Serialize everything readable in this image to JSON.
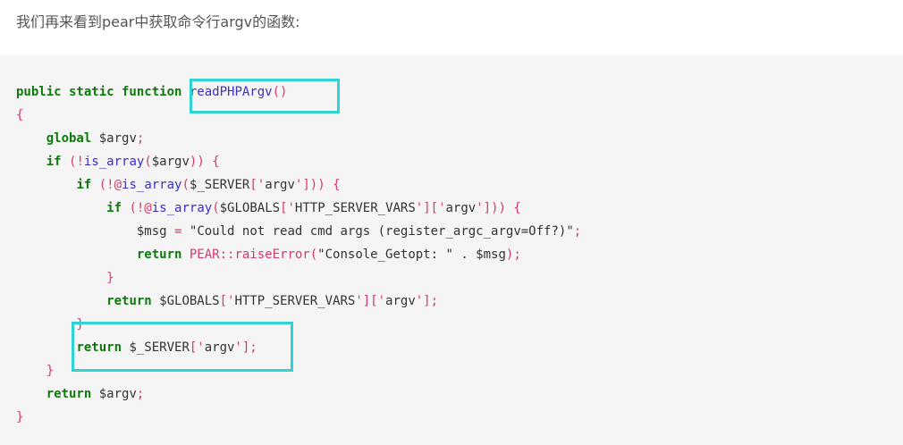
{
  "intro_text": "我们再来看到pear中获取命令行argv的函数:",
  "code_lines": [
    [
      [
        "kw",
        "public static function"
      ],
      [
        "var",
        " "
      ],
      [
        "fn",
        "readPHPArgv"
      ],
      [
        "pn",
        "()"
      ]
    ],
    [
      [
        "pn",
        "{"
      ]
    ],
    [
      [
        "var",
        "    "
      ],
      [
        "kw",
        "global"
      ],
      [
        "var",
        " $argv"
      ],
      [
        "pn",
        ";"
      ]
    ],
    [
      [
        "var",
        "    "
      ],
      [
        "kw",
        "if"
      ],
      [
        "var",
        " "
      ],
      [
        "pn",
        "(!"
      ],
      [
        "fn",
        "is_array"
      ],
      [
        "pn",
        "("
      ],
      [
        "var",
        "$argv"
      ],
      [
        "pn",
        ")) {"
      ]
    ],
    [
      [
        "var",
        "        "
      ],
      [
        "kw",
        "if"
      ],
      [
        "var",
        " "
      ],
      [
        "pn",
        "(!@"
      ],
      [
        "fn",
        "is_array"
      ],
      [
        "pn",
        "("
      ],
      [
        "var",
        "$_SERVER"
      ],
      [
        "pn",
        "['"
      ],
      [
        "str",
        "argv"
      ],
      [
        "pn",
        "'])) {"
      ]
    ],
    [
      [
        "var",
        "            "
      ],
      [
        "kw",
        "if"
      ],
      [
        "var",
        " "
      ],
      [
        "pn",
        "(!@"
      ],
      [
        "fn",
        "is_array"
      ],
      [
        "pn",
        "("
      ],
      [
        "var",
        "$GLOBALS"
      ],
      [
        "pn",
        "['"
      ],
      [
        "str",
        "HTTP_SERVER_VARS"
      ],
      [
        "pn",
        "']['"
      ],
      [
        "str",
        "argv"
      ],
      [
        "pn",
        "'])) {"
      ]
    ],
    [
      [
        "var",
        "                $msg "
      ],
      [
        "pn",
        "="
      ],
      [
        "var",
        " "
      ],
      [
        "str",
        "\"Could not read cmd args (register_argc_argv=Off?)\""
      ],
      [
        "pn",
        ";"
      ]
    ],
    [
      [
        "var",
        "                "
      ],
      [
        "kw",
        "return"
      ],
      [
        "var",
        " "
      ],
      [
        "cls",
        "PEAR::raiseError"
      ],
      [
        "pn",
        "("
      ],
      [
        "str",
        "\"Console_Getopt: \" . $msg"
      ],
      [
        "pn",
        ");"
      ]
    ],
    [
      [
        "var",
        "            "
      ],
      [
        "pn",
        "}"
      ]
    ],
    [
      [
        "var",
        "            "
      ],
      [
        "kw",
        "return"
      ],
      [
        "var",
        " $GLOBALS"
      ],
      [
        "pn",
        "['"
      ],
      [
        "str",
        "HTTP_SERVER_VARS"
      ],
      [
        "pn",
        "']['"
      ],
      [
        "str",
        "argv"
      ],
      [
        "pn",
        "'];"
      ]
    ],
    [
      [
        "var",
        "        "
      ],
      [
        "pn",
        "}"
      ]
    ],
    [
      [
        "var",
        "        "
      ],
      [
        "kw",
        "return"
      ],
      [
        "var",
        " $_SERVER"
      ],
      [
        "pn",
        "['"
      ],
      [
        "str",
        "argv"
      ],
      [
        "pn",
        "'];"
      ]
    ],
    [
      [
        "var",
        "    "
      ],
      [
        "pn",
        "}"
      ]
    ],
    [
      [
        "var",
        "    "
      ],
      [
        "kw",
        "return"
      ],
      [
        "var",
        " $argv"
      ],
      [
        "pn",
        ";"
      ]
    ],
    [
      [
        "pn",
        "}"
      ]
    ]
  ],
  "highlight_color": "#2fd3d6",
  "code_background": "#f5f5f5"
}
